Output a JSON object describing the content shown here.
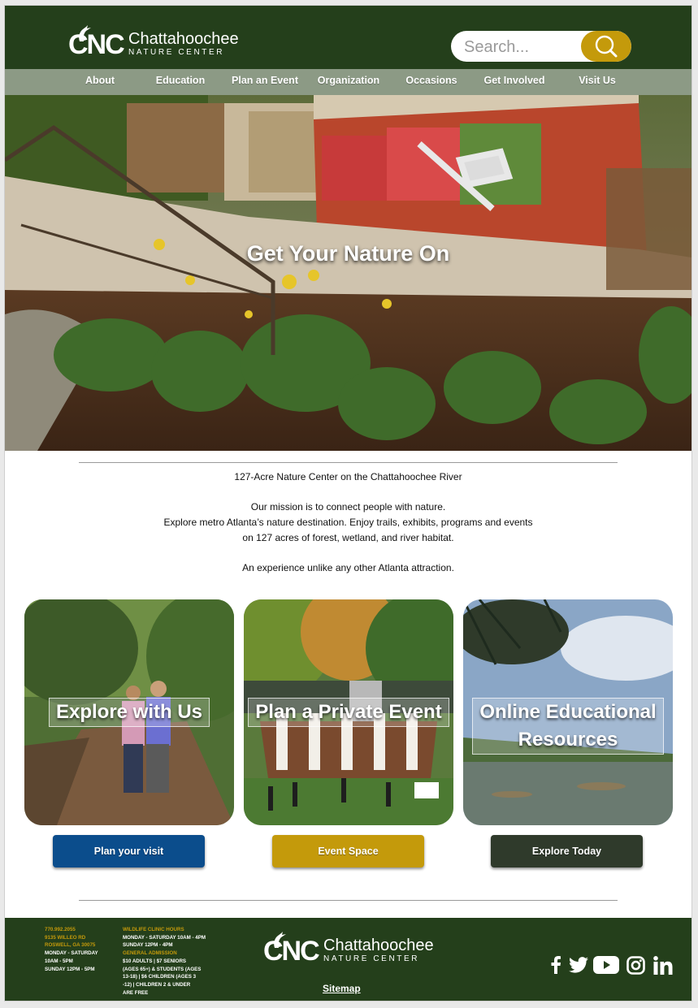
{
  "header": {
    "logo": {
      "mark": "CNC",
      "name": "Chattahoochee",
      "subtitle": "NATURE CENTER"
    },
    "search": {
      "placeholder": "Search..."
    }
  },
  "nav": {
    "items": [
      "About",
      "Education",
      "Plan an Event",
      "Organization",
      "Occasions",
      "Get Involved",
      "Visit Us"
    ]
  },
  "hero": {
    "title": "Get Your Nature On"
  },
  "intro": {
    "headline": "127-Acre Nature Center on the Chattahoochee River",
    "mission": "Our mission is to connect people with nature.",
    "line2": "Explore metro Atlanta’s nature destination. Enjoy trails, exhibits, programs and events",
    "line3": "on 127 acres of forest, wetland, and river habitat.",
    "tagline": "An experience unlike any other Atlanta attraction."
  },
  "cards": [
    {
      "label": "Explore with Us",
      "button": "Plan your visit"
    },
    {
      "label": "Plan a Private Event",
      "button": "Event Space"
    },
    {
      "label_line1": "Online Educational",
      "label_line2": "Resources",
      "button": "Explore Today"
    }
  ],
  "footer": {
    "contact": {
      "phone": "770.992.2055",
      "address1": "9135 WILLEO RD",
      "address2": "ROSWELL, GA 30075",
      "hours_label": "MONDAY - SATURDAY",
      "hours_time": "10AM - 5PM",
      "sunday": "SUNDAY 12PM - 5PM"
    },
    "clinic": {
      "title": "WILDLIFE CLINIC HOURS",
      "weekday": "MONDAY - SATURDAY 10AM - 4PM",
      "sunday": "SUNDAY 12PM - 4PM",
      "admission_title": "GENERAL ADMISSION",
      "admission_lines": [
        "$10 ADULTS | $7 SENIORS",
        "(AGES 65+) & STUDENTS (AGES",
        "13-18) | $6 CHILDREN (AGES 3",
        "-12) | CHILDREN 2 & UNDER",
        "ARE FREE"
      ]
    },
    "logo": {
      "mark": "CNC",
      "name": "Chattahoochee",
      "subtitle": "NATURE CENTER"
    },
    "sitemap": "Sitemap",
    "social": [
      "facebook-icon",
      "twitter-icon",
      "youtube-icon",
      "instagram-icon",
      "linkedin-icon"
    ]
  },
  "colors": {
    "header_green": "#243f1b",
    "nav_gray_green": "#8c9a85",
    "gold": "#c49a0b",
    "blue_button": "#0b4d8c",
    "dark_button": "#2f3a2b"
  }
}
